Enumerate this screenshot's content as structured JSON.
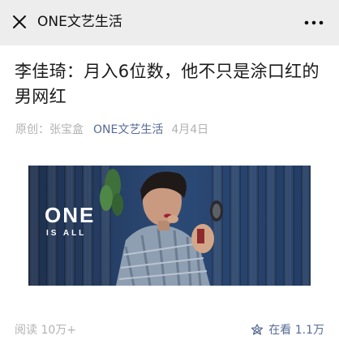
{
  "nav": {
    "title": "ONE文艺生活"
  },
  "article": {
    "title": "李佳琦：月入6位数，他不只是涂口红的男网红",
    "original_label": "原创：",
    "author": "张宝盒",
    "account": "ONE文艺生活",
    "date": "4月4日",
    "banner": {
      "brand_line1": "ONE",
      "brand_line2": "IS ALL"
    }
  },
  "footer": {
    "reads": "阅读 10万+",
    "wow_label": "在看 1.1万"
  },
  "colors": {
    "link": "#576b95",
    "muted": "#b2b2b2",
    "nav_bg": "#ededed"
  },
  "icons": {
    "close": "close-icon",
    "more": "more-icon",
    "wow": "wow-icon"
  }
}
